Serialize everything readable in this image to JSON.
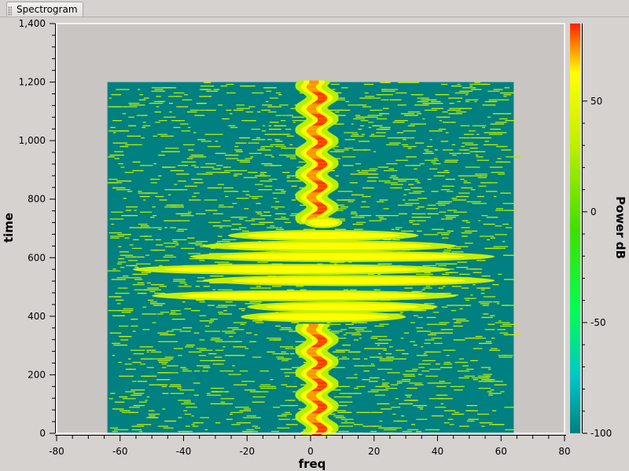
{
  "tab": {
    "label": "Spectrogram"
  },
  "colors": {
    "background": "#c9c5c3",
    "frame": "#d6d2d0",
    "colormap": [
      "#008080",
      "#00c8c8",
      "#00ff50",
      "#40e000",
      "#c8f000",
      "#ffff00",
      "#ff8000",
      "#ff2000"
    ]
  },
  "chart_data": {
    "type": "heatmap",
    "title": "",
    "xlabel": "freq",
    "ylabel": "time",
    "xlim": [
      -80,
      80
    ],
    "ylim": [
      0,
      1400
    ],
    "x_ticks": [
      -80,
      -60,
      -40,
      -20,
      0,
      20,
      40,
      60,
      80
    ],
    "x_tick_labels": [
      "-80",
      "-60",
      "-40",
      "-20",
      "0",
      "20",
      "40",
      "60",
      "80"
    ],
    "y_ticks": [
      0,
      200,
      400,
      600,
      800,
      1000,
      1200,
      1400
    ],
    "y_tick_labels": [
      "0",
      "200",
      "400",
      "600",
      "800",
      "1,000",
      "1,200",
      "1,400"
    ],
    "data_extent": {
      "freq": [
        -64,
        64
      ],
      "time": [
        0,
        1200
      ]
    },
    "grid": false,
    "colorbar": {
      "label": "Power dB",
      "range": [
        -100,
        85
      ],
      "ticks": [
        -100,
        -50,
        0,
        50
      ],
      "tick_labels": [
        "-100",
        "-50",
        "0",
        "50"
      ],
      "position": "right"
    },
    "features": {
      "carrier_center_freq": 2,
      "carrier_half_width": 5,
      "carrier_time_ranges": [
        [
          0,
          370
        ],
        [
          720,
          1200
        ]
      ],
      "chirp_time_range": [
        380,
        710
      ],
      "chirp_max_half_width": 58,
      "noise_floor_db": -100
    }
  }
}
